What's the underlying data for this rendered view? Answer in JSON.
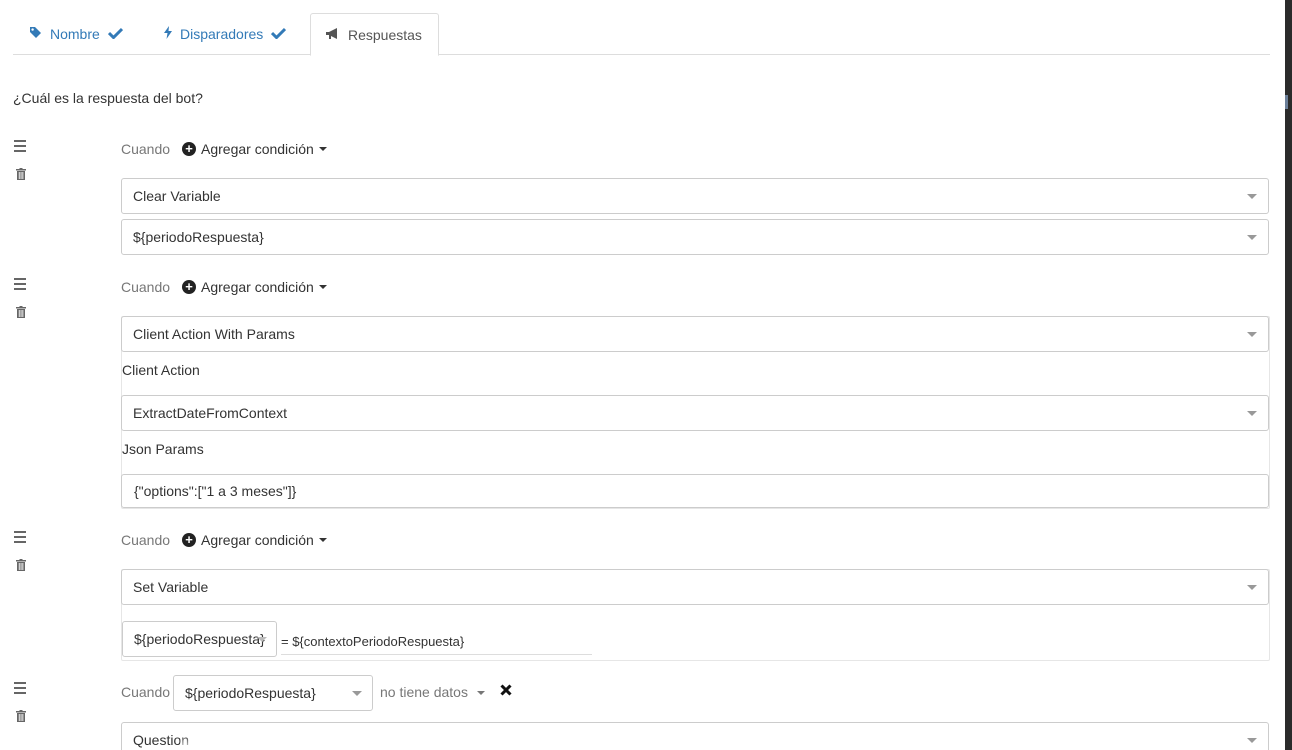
{
  "tabs": [
    {
      "label": "Nombre",
      "icon": "tag-icon",
      "completed": true
    },
    {
      "label": "Disparadores",
      "icon": "bolt-icon",
      "completed": true
    },
    {
      "label": "Respuestas",
      "icon": "bullhorn-icon",
      "active": true
    }
  ],
  "question": "¿Cuál es la respuesta del bot?",
  "responses": [
    {
      "when_label": "Cuando",
      "add_condition_label": "Agregar condición",
      "type": "Clear Variable",
      "variable": "${periodoRespuesta}"
    },
    {
      "when_label": "Cuando",
      "add_condition_label": "Agregar condición",
      "type": "Client Action With Params",
      "client_action_label": "Client Action",
      "client_action": "ExtractDateFromContext",
      "json_params_label": "Json Params",
      "json_params": "{\"options\":[\"1 a 3 meses\"]}"
    },
    {
      "when_label": "Cuando",
      "add_condition_label": "Agregar condición",
      "type": "Set Variable",
      "variable": "${periodoRespuesta}",
      "assignment": "= ${contextoPeriodoRespuesta}"
    },
    {
      "when_label": "Cuando",
      "condition_variable": "${periodoRespuesta}",
      "condition_operator": "no tiene datos",
      "type": "Question"
    }
  ],
  "colors": {
    "link": "#337ab7",
    "border": "#cccccc",
    "muted": "#777777"
  }
}
